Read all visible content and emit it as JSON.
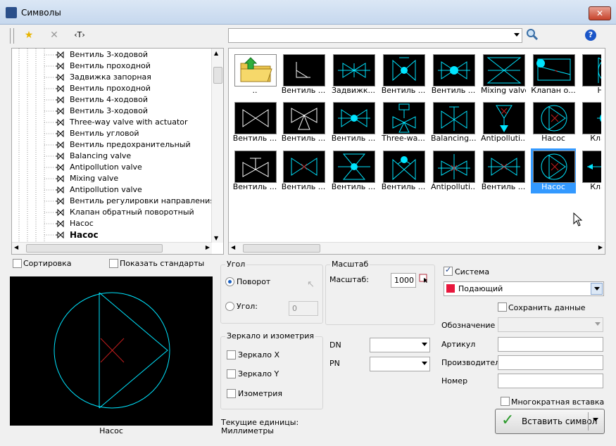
{
  "window": {
    "title": "Символы",
    "close_label": "✕"
  },
  "toolbar": {
    "text_tool_label": "‹T›"
  },
  "search": {
    "value": ""
  },
  "tree": {
    "items": [
      {
        "label": "Вентиль 3-ходовой"
      },
      {
        "label": "Вентиль проходной"
      },
      {
        "label": "Задвижка запорная"
      },
      {
        "label": "Вентиль проходной"
      },
      {
        "label": "Вентиль 4-ходовой"
      },
      {
        "label": "Вентиль 3-ходовой"
      },
      {
        "label": "Three-way valve with actuator"
      },
      {
        "label": "Вентиль угловой"
      },
      {
        "label": "Вентиль предохранительный"
      },
      {
        "label": "Balancing valve"
      },
      {
        "label": "Antipollution valve"
      },
      {
        "label": "Mixing valve"
      },
      {
        "label": "Antipollution valve"
      },
      {
        "label": "Вентиль регулировки направления"
      },
      {
        "label": "Клапан обратный поворотный"
      },
      {
        "label": "Насос"
      },
      {
        "label": "Насос"
      }
    ]
  },
  "grid": {
    "row1": [
      {
        "label": ".."
      },
      {
        "label": "Вентиль ..."
      },
      {
        "label": "Задвижк..."
      },
      {
        "label": "Вентиль ..."
      },
      {
        "label": "Вентиль ..."
      },
      {
        "label": "Mixing valve"
      },
      {
        "label": "Клапан о..."
      },
      {
        "label": "На"
      }
    ],
    "row2": [
      {
        "label": "Вентиль ..."
      },
      {
        "label": "Вентиль ..."
      },
      {
        "label": "Вентиль ..."
      },
      {
        "label": "Three-wa..."
      },
      {
        "label": "Balancing..."
      },
      {
        "label": "Antipolluti..."
      },
      {
        "label": "Насос"
      },
      {
        "label": "Клапа"
      }
    ],
    "row3": [
      {
        "label": "Вентиль ..."
      },
      {
        "label": "Вентиль ..."
      },
      {
        "label": "Вентиль ..."
      },
      {
        "label": "Вентиль ..."
      },
      {
        "label": "Antipolluti..."
      },
      {
        "label": "Вентиль ..."
      },
      {
        "label": "Насос"
      },
      {
        "label": "Клапа"
      }
    ]
  },
  "options": {
    "sort_label": "Сортировка",
    "show_standards_label": "Показать стандарты"
  },
  "preview": {
    "caption": "Насос"
  },
  "angle": {
    "title": "Угол",
    "rotate_label": "Поворот",
    "angle_label": "Угол:",
    "angle_value": "0"
  },
  "mirror": {
    "title": "Зеркало и изометрия",
    "mirror_x": "Зеркало X",
    "mirror_y": "Зеркало Y",
    "isometry": "Изометрия"
  },
  "units": {
    "label": "Текущие единицы:",
    "value": "Миллиметры"
  },
  "scale": {
    "title": "Масштаб",
    "label": "Масштаб:",
    "value": "1000"
  },
  "dn_pn": {
    "dn_label": "DN",
    "pn_label": "PN"
  },
  "system": {
    "label": "Система",
    "value": "Подающий",
    "color": "#e8173d"
  },
  "properties": {
    "save_data_label": "Сохранить данные",
    "designation_label": "Обозначение",
    "article_label": "Артикул",
    "manufacturer_label": "Производитель",
    "number_label": "Номер"
  },
  "insert": {
    "multi_insert_label": "Многократная вставка",
    "button_label": "Вставить символ"
  },
  "colors": {
    "cyan": "#00e5ff",
    "red": "#c41e1e",
    "selection": "#3399ff"
  }
}
